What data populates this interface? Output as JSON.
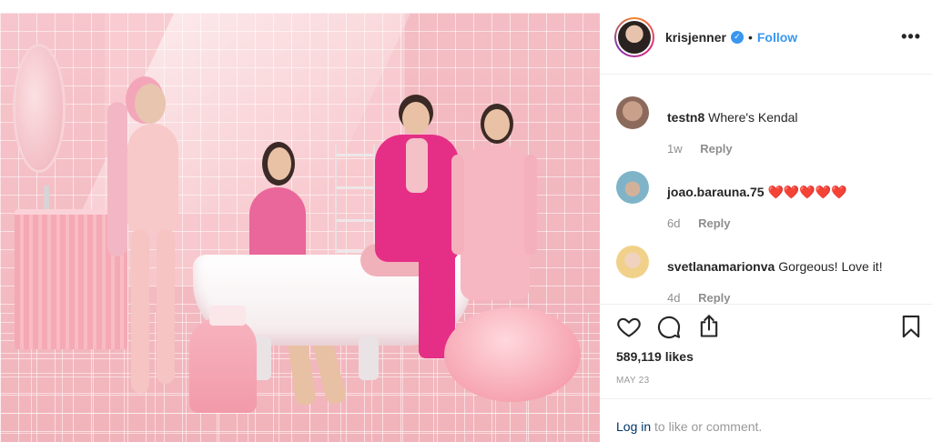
{
  "header": {
    "username": "krisjenner",
    "separator": "•",
    "follow_label": "Follow",
    "more_label": "•••"
  },
  "comments": [
    {
      "user": "testn8",
      "text": "Where's Kendal",
      "time": "1w",
      "reply": "Reply"
    },
    {
      "user": "joao.barauna.75",
      "text": "❤️❤️❤️❤️❤️",
      "time": "6d",
      "reply": "Reply"
    },
    {
      "user": "svetlanamarionva",
      "text": "Gorgeous! Love it!",
      "time": "4d",
      "reply": "Reply"
    }
  ],
  "icons": {
    "like": "heart-icon",
    "comment": "comment-icon",
    "share": "share-icon",
    "save": "bookmark-icon"
  },
  "likes_label": "589,119 likes",
  "date_label": "MAY 23",
  "login": {
    "link": "Log in",
    "rest": " to like or comment."
  },
  "colors": {
    "link_blue": "#3897f0",
    "heart_red": "#ed4956",
    "muted_gray": "#8e8e8e",
    "photo_pink": "#f4bcc3"
  }
}
